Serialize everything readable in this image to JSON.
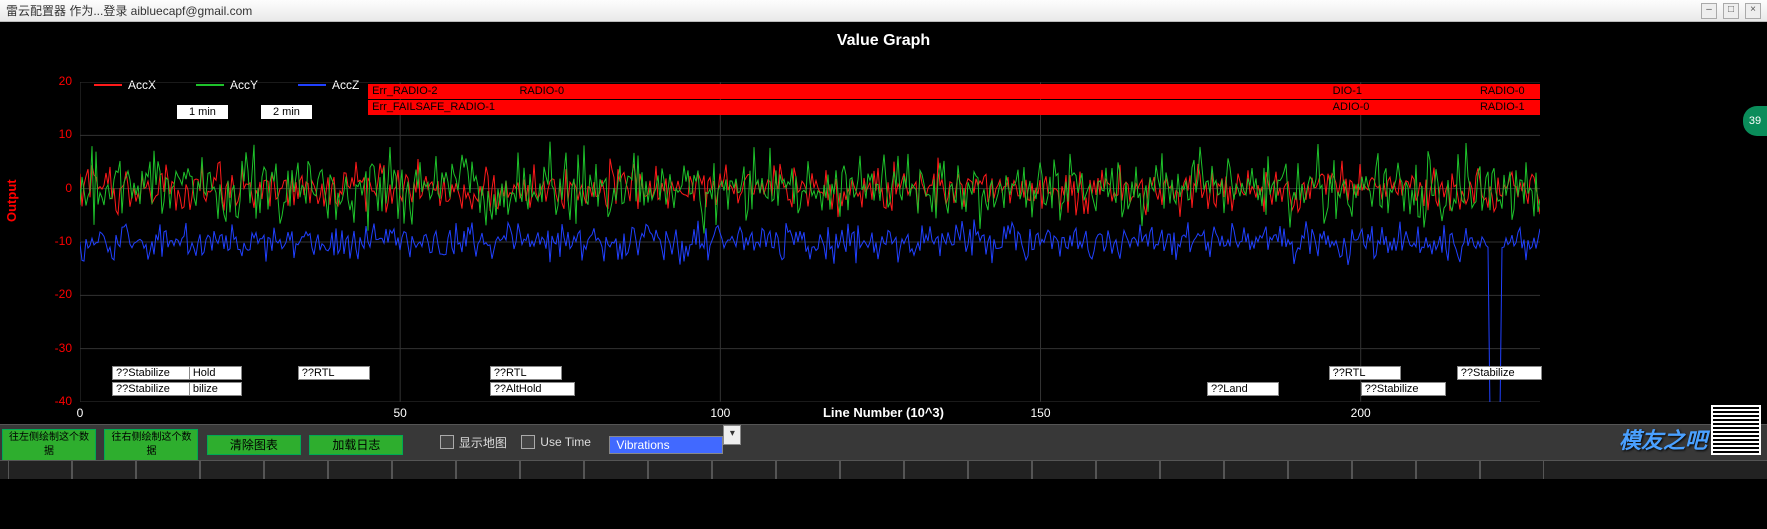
{
  "window": {
    "title": "雷云配置器 作为...登录 aibluecapf@gmail.com"
  },
  "chart_data": {
    "type": "line",
    "title": "Value Graph",
    "xlabel": "Line Number (10^3)",
    "ylabel": "Output",
    "xlim": [
      0,
      228
    ],
    "ylim": [
      -40,
      20
    ],
    "yticks": [
      -40,
      -30,
      -20,
      -10,
      0,
      10,
      20
    ],
    "xticks": [
      0,
      50,
      100,
      150,
      200
    ],
    "legend": [
      "AccX",
      "AccY",
      "AccZ"
    ],
    "colors": {
      "AccX": "#ff1a1a",
      "AccY": "#1ec22b",
      "AccZ": "#2040ff"
    },
    "series": [
      {
        "name": "AccX",
        "mean": 0,
        "amplitude": 4,
        "note": "high-frequency noise centred on 0"
      },
      {
        "name": "AccY",
        "mean": 0,
        "amplitude": 6,
        "note": "high-frequency noise centred on 0, slightly larger than AccX"
      },
      {
        "name": "AccZ",
        "mean": -10,
        "amplitude": 3,
        "note": "high-frequency noise centred on -10; large transient spike near x≈221 down past -40"
      }
    ],
    "error_bands": [
      {
        "row": 0,
        "label": "Err_RADIO-2",
        "x0": 45,
        "x1": 68
      },
      {
        "row": 0,
        "label": "RADIO-0",
        "x0": 68,
        "x1": 195
      },
      {
        "row": 0,
        "label": "DIO-1",
        "x0": 195,
        "x1": 218
      },
      {
        "row": 0,
        "label": "RADIO-0",
        "x0": 218,
        "x1": 228
      },
      {
        "row": 1,
        "label": "Err_FAILSAFE_RADIO-1",
        "x0": 45,
        "x1": 195
      },
      {
        "row": 1,
        "label": "ADIO-0",
        "x0": 195,
        "x1": 218
      },
      {
        "row": 1,
        "label": "RADIO-1",
        "x0": 218,
        "x1": 228
      }
    ],
    "modes_upper": [
      {
        "label": "??Stabilize",
        "x0": 5,
        "x1": 17
      },
      {
        "label": "Hold",
        "x0": 17,
        "x1": 25
      },
      {
        "label": "??RTL",
        "x0": 34,
        "x1": 45
      },
      {
        "label": "??RTL",
        "x0": 64,
        "x1": 75
      },
      {
        "label": "??RTL",
        "x0": 195,
        "x1": 206
      },
      {
        "label": "??Stabilize",
        "x0": 215,
        "x1": 228
      }
    ],
    "modes_lower": [
      {
        "label": "??Stabilize",
        "x0": 5,
        "x1": 17
      },
      {
        "label": "bilize",
        "x0": 17,
        "x1": 25
      },
      {
        "label": "??AltHold",
        "x0": 64,
        "x1": 77
      },
      {
        "label": "??Land",
        "x0": 176,
        "x1": 187
      },
      {
        "label": "??Stabilize",
        "x0": 200,
        "x1": 213
      }
    ],
    "time_buttons": [
      "1 min",
      "2 min"
    ]
  },
  "toolbar": {
    "btn_pan_left": "往左侧绘制这个数\n据",
    "btn_pan_right": "往右侧绘制这个数\n据",
    "btn_clear": "清除图表",
    "btn_load": "加载日志",
    "chk_map": "显示地图",
    "chk_usetime": "Use Time",
    "select_value": "Vibrations"
  },
  "badge": "39",
  "watermark": "模友之吧"
}
